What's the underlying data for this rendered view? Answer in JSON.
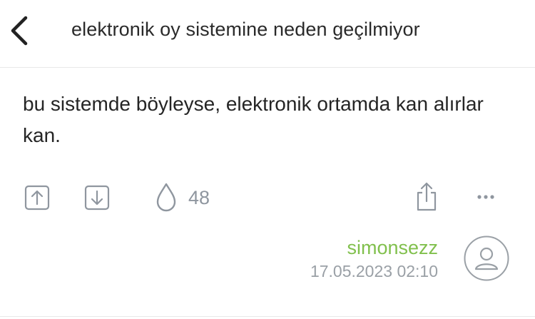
{
  "header": {
    "back_icon": "chevron-left-icon",
    "title": "elektronik oy sistemine neden geçilmiyor"
  },
  "entry": {
    "text": "bu sistemde böyleyse, elektronik ortamda kan alırlar kan."
  },
  "actions": {
    "upvote_icon": "arrow-up-box-icon",
    "downvote_icon": "arrow-down-box-icon",
    "favorite_icon": "drop-icon",
    "favorite_count": "48",
    "share_icon": "share-icon",
    "more_icon": "more-dots-icon"
  },
  "author": {
    "name": "simonsezz",
    "date": "17.05.2023 02:10",
    "avatar_icon": "user-avatar-icon"
  },
  "colors": {
    "author": "#81c04d",
    "icon": "#8f969f",
    "text": "#252525"
  }
}
